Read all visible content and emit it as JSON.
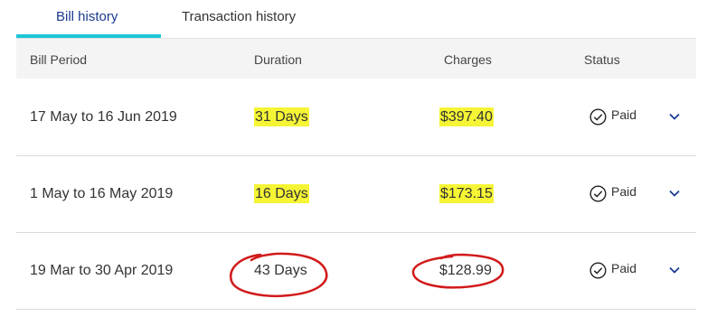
{
  "tabs": [
    {
      "label": "Bill history",
      "active": true
    },
    {
      "label": "Transaction history",
      "active": false
    }
  ],
  "columns": [
    "Bill Period",
    "Duration",
    "Charges",
    "Status"
  ],
  "rows": [
    {
      "period": "17 May to 16 Jun 2019",
      "duration": "31 Days",
      "charges": "$397.40",
      "status": "Paid",
      "highlight": "yellow"
    },
    {
      "period": "1 May to 16 May 2019",
      "duration": "16 Days",
      "charges": "$173.15",
      "status": "Paid",
      "highlight": "yellow"
    },
    {
      "period": "19 Mar to 30 Apr 2019",
      "duration": "43 Days",
      "charges": "$128.99",
      "status": "Paid",
      "highlight": "red-circle"
    }
  ],
  "colors": {
    "active_tab_text": "#1a3a8f",
    "tab_underline": "#1ec7d6",
    "highlight": "#f5f535",
    "annotation_red": "#d11a1a",
    "chevron": "#1a3a8f"
  },
  "icons": [
    "check-circle-icon",
    "chevron-down-icon"
  ]
}
